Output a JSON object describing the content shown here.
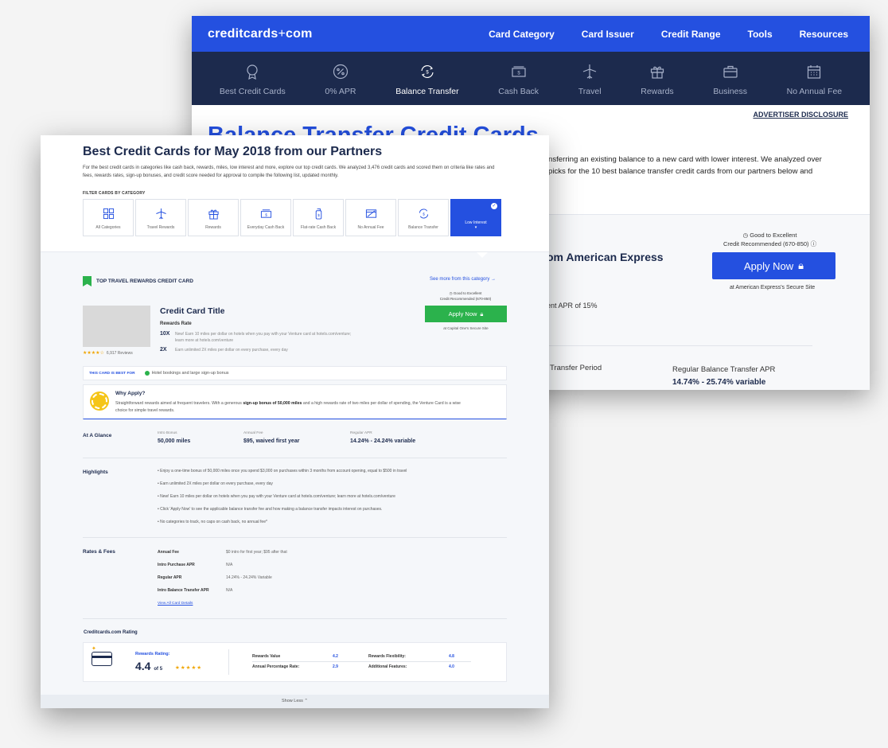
{
  "back": {
    "logo_a": "creditcards",
    "logo_plus": "+",
    "logo_b": "com",
    "topnav": [
      "Card Category",
      "Card Issuer",
      "Credit Range",
      "Tools",
      "Resources"
    ],
    "categories": [
      {
        "label": "Best Credit Cards",
        "icon": "award-icon"
      },
      {
        "label": "0% APR",
        "icon": "percent-icon"
      },
      {
        "label": "Balance Transfer",
        "icon": "transfer-icon",
        "active": true
      },
      {
        "label": "Cash Back",
        "icon": "cash-icon"
      },
      {
        "label": "Travel",
        "icon": "plane-icon"
      },
      {
        "label": "Rewards",
        "icon": "gift-icon"
      },
      {
        "label": "Business",
        "icon": "briefcase-icon"
      },
      {
        "label": "No Annual Fee",
        "icon": "calendar-icon"
      }
    ],
    "disclosure": "ADVERTISER DISCLOSURE",
    "title": "Balance Transfer Credit Cards",
    "desc_line1": "nsferring an existing balance to a new card with lower interest. We analyzed over",
    "desc_line2": "picks for the 10 best balance transfer credit cards from our partners below and",
    "good_line1": "Good to Excellent",
    "good_line2": "Credit Recommended (670-850)",
    "amex_title": "om American Express",
    "apply_label": "Apply Now",
    "secure": "at American Express's Secure Site",
    "apr_text": "ent APR of 15%",
    "transfer_period": "Transfer Period",
    "regular_label": "Regular Balance Transfer APR",
    "regular_value": "14.74% - 25.74% variable"
  },
  "front": {
    "title": "Best Credit Cards for May 2018 from our Partners",
    "intro": "For the best credit cards in categories like cash back, rewards, miles, low interest and more, explore our top credit cards. We analyzed 3,476 credit cards and scored them on criteria like rates and fees, rewards rates, sign-up bonuses, and credit score needed for approval to compile the following list, updated monthly.",
    "filter_label": "FILTER CARDS BY CATEGORY",
    "filters": [
      {
        "label": "All Categories"
      },
      {
        "label": "Travel Rewards"
      },
      {
        "label": "Rewards"
      },
      {
        "label": "Everyday Cash Back"
      },
      {
        "label": "Flat-rate Cash Back"
      },
      {
        "label": "No Annual Fee"
      },
      {
        "label": "Balance Transfer"
      },
      {
        "label": "Low Interest"
      }
    ],
    "section_title": "TOP TRAVEL REWARDS CREDIT CARD",
    "see_more": "See more from this category",
    "card_title": "Credit Card Title",
    "reviews": "6,917 Reviews",
    "rewards_rate_label": "Rewards Rate",
    "rr1_x": "10X",
    "rr1_t": "New! Earn 10 miles per dollar on hotels when you pay with your Venture card at hotels.com/venture; learn more at hotels.com/venture",
    "rr2_x": "2X",
    "rr2_t": "Earn unlimited 2X miles per dollar on every purchase, every day",
    "good_line1": "Good to Excellent",
    "good_line2": "Credit Recommended (670-850)",
    "apply_label": "Apply Now",
    "secure": "at Capital One's Secure Site",
    "best_for_label": "THIS CARD IS BEST FOR",
    "best_for_value": "Hotel bookings and large sign-up bonus",
    "why_title": "Why Apply?",
    "why_pre": "Straightforward rewards aimed at frequent travelers. With a generous ",
    "why_bold": "sign-up bonus of 50,000 miles",
    "why_post": " and a high rewards rate of two miles per dollar of spending, the Venture Card is a wise choice for simple travel rewards.",
    "glance_label": "At A Glance",
    "glance": [
      {
        "k": "Intro Bonus",
        "v": "50,000 miles"
      },
      {
        "k": "Annual Fee",
        "v": "$95, waived first year"
      },
      {
        "k": "Regular APR",
        "v": "14.24% - 24.24% variable"
      }
    ],
    "highlights_label": "Highlights",
    "highlights": [
      "• Enjoy a one-time bonus of 50,000 miles once you spend $3,000 on purchases within 3 months from account opening, equal to $500 in travel",
      "• Earn unlimited 2X miles per dollar on every purchase, every day",
      "• New! Earn 10 miles per dollar on hotels when you pay with your Venture card at hotels.com/venture; learn more at hotels.com/venture",
      "• Click 'Apply Now' to see the applicable balance transfer fee and how making a balance transfer impacts interest on purchases.",
      "• No categories to track, no caps on cash back, no annual fee*"
    ],
    "rates_label": "Rates & Fees",
    "rates": [
      {
        "k": "Annual Fee",
        "v": "$0 intro for first year; $95 after that"
      },
      {
        "k": "Intro Purchase APR",
        "v": "N/A"
      },
      {
        "k": "Regular APR",
        "v": "14.24% - 24.24% Variable"
      },
      {
        "k": "Intro Balance Transfer APR",
        "v": "N/A"
      }
    ],
    "view_all": "View All Card Details",
    "rating_label": "Creditcards.com Rating",
    "rewards_rating_label": "Rewards Rating:",
    "rating_value": "4.4",
    "rating_of": "of 5",
    "metrics": [
      {
        "k": "Rewards Value",
        "v": "4.2"
      },
      {
        "k": "Rewards Flexibility:",
        "v": "4.8"
      },
      {
        "k": "Annual Percentage Rate:",
        "v": "2.9"
      },
      {
        "k": "Additional Features:",
        "v": "4.0"
      }
    ],
    "show_less": "Show Less"
  }
}
